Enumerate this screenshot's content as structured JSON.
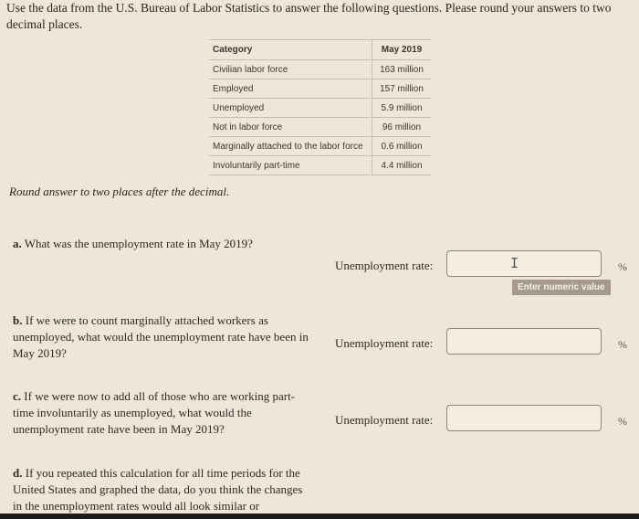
{
  "intro_text": "Use the data from the U.S. Bureau of Labor Statistics to answer the following questions. Please round your answers to two decimal places.",
  "table": {
    "headers": [
      "Category",
      "May 2019"
    ],
    "rows": [
      [
        "Civilian labor force",
        "163 million"
      ],
      [
        "Employed",
        "157 million"
      ],
      [
        "Unemployed",
        "5.9 million"
      ],
      [
        "Not in labor force",
        "96 million"
      ],
      [
        "Marginally attached to the labor force",
        "0.6 million"
      ],
      [
        "Involuntarily part-time",
        "4.4 million"
      ]
    ]
  },
  "round_note": "Round answer to two places after the decimal.",
  "questions": [
    {
      "letter": "a.",
      "text": "What was the unemployment rate in May 2019?",
      "answer_label": "Unemployment rate:",
      "answer_value": "",
      "unit": "%",
      "tooltip": "Enter numeric value"
    },
    {
      "letter": "b.",
      "text": "If we were to count marginally attached workers as unemployed, what would the unemployment rate have been in May 2019?",
      "answer_label": "Unemployment rate:",
      "answer_value": "",
      "unit": "%"
    },
    {
      "letter": "c.",
      "text": "If we were now to add all of those who are working part-time involuntarily as unemployed, what would the unemployment rate have been in May 2019?",
      "answer_label": "Unemployment rate:",
      "answer_value": "",
      "unit": "%"
    },
    {
      "letter": "d.",
      "text": "If you repeated this calculation for all time periods for the United States and graphed the data, do you think the changes in the unemployment rates would all look similar or"
    }
  ],
  "cursor_icon": "text-cursor-icon",
  "colors": {
    "background": "#efe6d8",
    "tooltip_bg": "#a59a8d",
    "input_border": "#8f857a"
  }
}
